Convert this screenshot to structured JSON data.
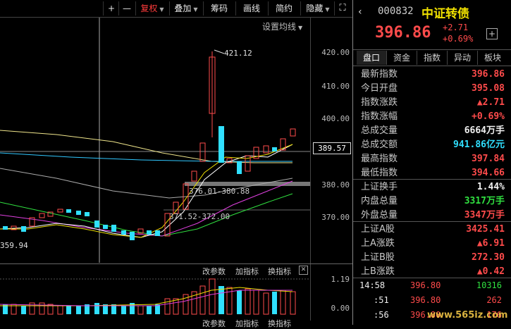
{
  "toolbar": {
    "plus": "+",
    "minus": "—",
    "fuquan": "复权",
    "diejia": "叠加",
    "chouma": "筹码",
    "huaxian": "画线",
    "jianji": "简约",
    "yincang": "隐藏"
  },
  "chart": {
    "set_ma": "设置均线",
    "axis_labels": [
      "420.00",
      "410.00",
      "400.00",
      "380.00",
      "370.00"
    ],
    "current_price": "389.57",
    "high_annotation": "421.12",
    "low_annotation": "359.94",
    "range1": "376.01-380.88",
    "range2": "371.52-372.00",
    "vol_axis": [
      "1.19",
      "0.00"
    ],
    "indicator_buttons": [
      "改参数",
      "加指标",
      "换指标"
    ]
  },
  "quote": {
    "code": "000832",
    "name": "中证转债",
    "price": "396.86",
    "change": "+2.71",
    "change_pct": "+0.69%",
    "add": "+"
  },
  "tabs": [
    "盘口",
    "资金",
    "指数",
    "异动",
    "板块"
  ],
  "panel": [
    {
      "k": "最新指数",
      "v": "396.86",
      "c": "red"
    },
    {
      "k": "今日开盘",
      "v": "395.08",
      "c": "red"
    },
    {
      "k": "指数涨跌",
      "v": "▲2.71",
      "c": "red"
    },
    {
      "k": "指数涨幅",
      "v": "+0.69%",
      "c": "red"
    },
    {
      "k": "总成交量",
      "v": "6664万手",
      "c": "white"
    },
    {
      "k": "总成交额",
      "v": "941.86亿元",
      "c": "cyan"
    },
    {
      "k": "最高指数",
      "v": "397.84",
      "c": "red"
    },
    {
      "k": "最低指数",
      "v": "394.66",
      "c": "red"
    }
  ],
  "panel2": [
    {
      "k": "上证换手",
      "v": "1.44%",
      "c": "white"
    },
    {
      "k": "内盘总量",
      "v": "3317万手",
      "c": "green"
    },
    {
      "k": "外盘总量",
      "v": "3347万手",
      "c": "red"
    }
  ],
  "panel3": [
    {
      "k": "上证A股",
      "v": "3425.41",
      "c": "red"
    },
    {
      "k": "上A涨跌",
      "v": "▲6.91",
      "c": "red"
    },
    {
      "k": "上证B股",
      "v": "272.30",
      "c": "red"
    },
    {
      "k": "上B涨跌",
      "v": "▲0.42",
      "c": "red"
    }
  ],
  "ticks": [
    {
      "t": "14:58",
      "p": "396.80",
      "v": "10316"
    },
    {
      "t": ":51",
      "p": "396.80",
      "v": "262"
    },
    {
      "t": ":56",
      "p": "396.80",
      "v": "176"
    }
  ],
  "watermark": "www.565iz.com"
}
